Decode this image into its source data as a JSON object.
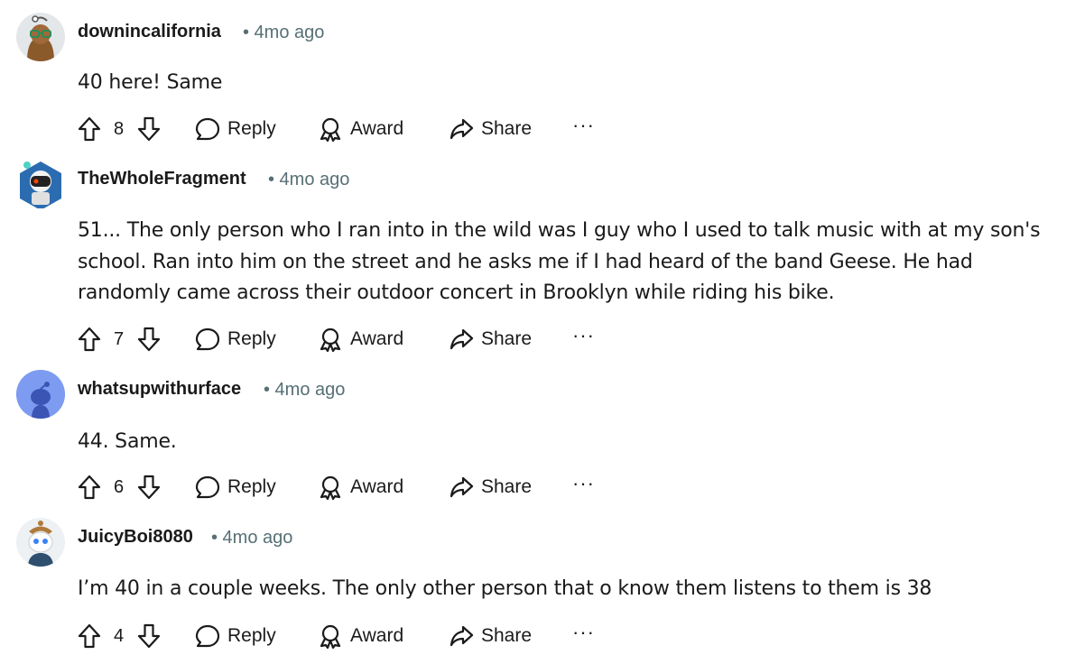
{
  "comments": [
    {
      "username": "downincalifornia",
      "time": "• 4mo ago",
      "text": "40 here! Same",
      "votes": "8",
      "avatar": "avatar-green-glasses",
      "actions": {
        "reply": "Reply",
        "award": "Award",
        "share": "Share",
        "more": "···"
      }
    },
    {
      "username": "TheWholeFragment",
      "time": "• 4mo ago",
      "text": "51... The only person who I ran into in the wild was I guy who I used to talk music with at my son's school. Ran into him on the street and he asks me if I had heard of the band Geese. He had randomly came across their outdoor concert in Brooklyn while riding his bike.",
      "votes": "7",
      "avatar": "avatar-robot",
      "actions": {
        "reply": "Reply",
        "award": "Award",
        "share": "Share",
        "more": "···"
      }
    },
    {
      "username": "whatsupwithurface",
      "time": "• 4mo ago",
      "text": "44. Same.",
      "votes": "6",
      "avatar": "avatar-default-snoo",
      "actions": {
        "reply": "Reply",
        "award": "Award",
        "share": "Share",
        "more": "···"
      }
    },
    {
      "username": "JuicyBoi8080",
      "time": "• 4mo ago",
      "text": "I’m 40 in a couple weeks. The only other person that o know them listens to them is 38",
      "votes": "4",
      "avatar": "avatar-snoo-hat",
      "actions": {
        "reply": "Reply",
        "award": "Award",
        "share": "Share",
        "more": "···"
      }
    }
  ]
}
